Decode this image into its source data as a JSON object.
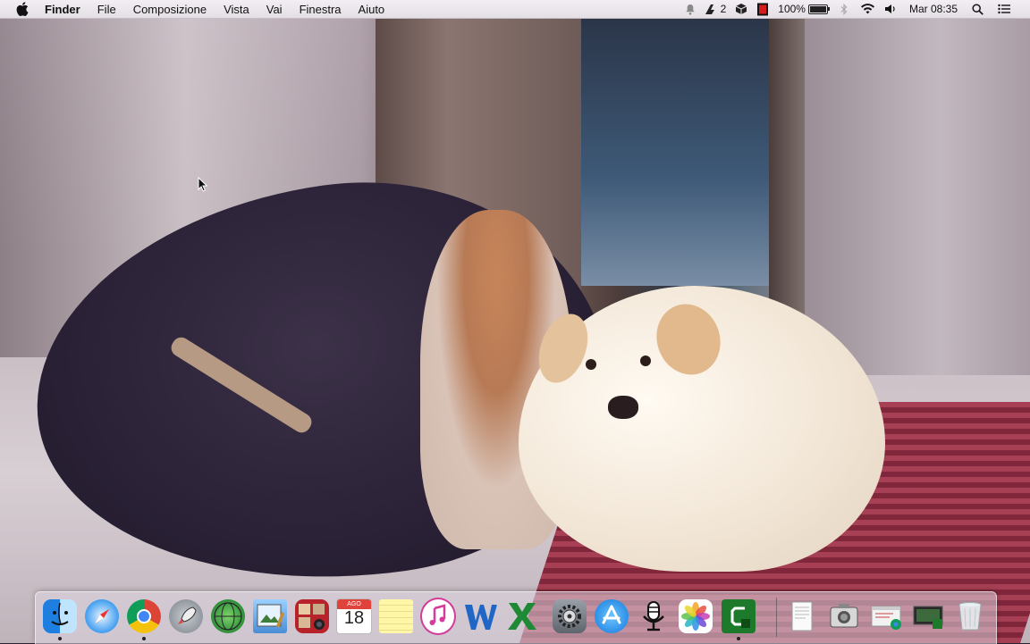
{
  "menubar": {
    "app_name": "Finder",
    "items": [
      "File",
      "Composizione",
      "Vista",
      "Vai",
      "Finestra",
      "Aiuto"
    ],
    "status": {
      "adobe_badge": "2",
      "battery_percent": "100%",
      "clock": "Mar 08:35"
    }
  },
  "dock": {
    "calendar": {
      "month": "AGO",
      "day": "18"
    },
    "apps": [
      {
        "name": "Finder",
        "running": true
      },
      {
        "name": "Safari",
        "running": false
      },
      {
        "name": "Google Chrome",
        "running": true
      },
      {
        "name": "Launchpad",
        "running": false
      },
      {
        "name": "Mappa",
        "running": false
      },
      {
        "name": "Anteprima",
        "running": false
      },
      {
        "name": "Photo Booth",
        "running": false
      },
      {
        "name": "Calendario",
        "running": false
      },
      {
        "name": "Note",
        "running": false
      },
      {
        "name": "iTunes",
        "running": false
      },
      {
        "name": "Word",
        "running": false
      },
      {
        "name": "Excel",
        "running": false
      },
      {
        "name": "Preferenze di Sistema",
        "running": false
      },
      {
        "name": "App Store",
        "running": false
      },
      {
        "name": "Podcast",
        "running": false
      },
      {
        "name": "Foto",
        "running": false
      },
      {
        "name": "Camtasia",
        "running": true
      }
    ],
    "others": [
      {
        "name": "Documenti"
      },
      {
        "name": "Cattura"
      },
      {
        "name": "Download"
      },
      {
        "name": "Desktop"
      },
      {
        "name": "Cestino"
      }
    ]
  },
  "colors": {
    "menubar_bg": "#ece7ed",
    "dock_bg": "#dcd6e0",
    "running_dot": "#222222"
  }
}
